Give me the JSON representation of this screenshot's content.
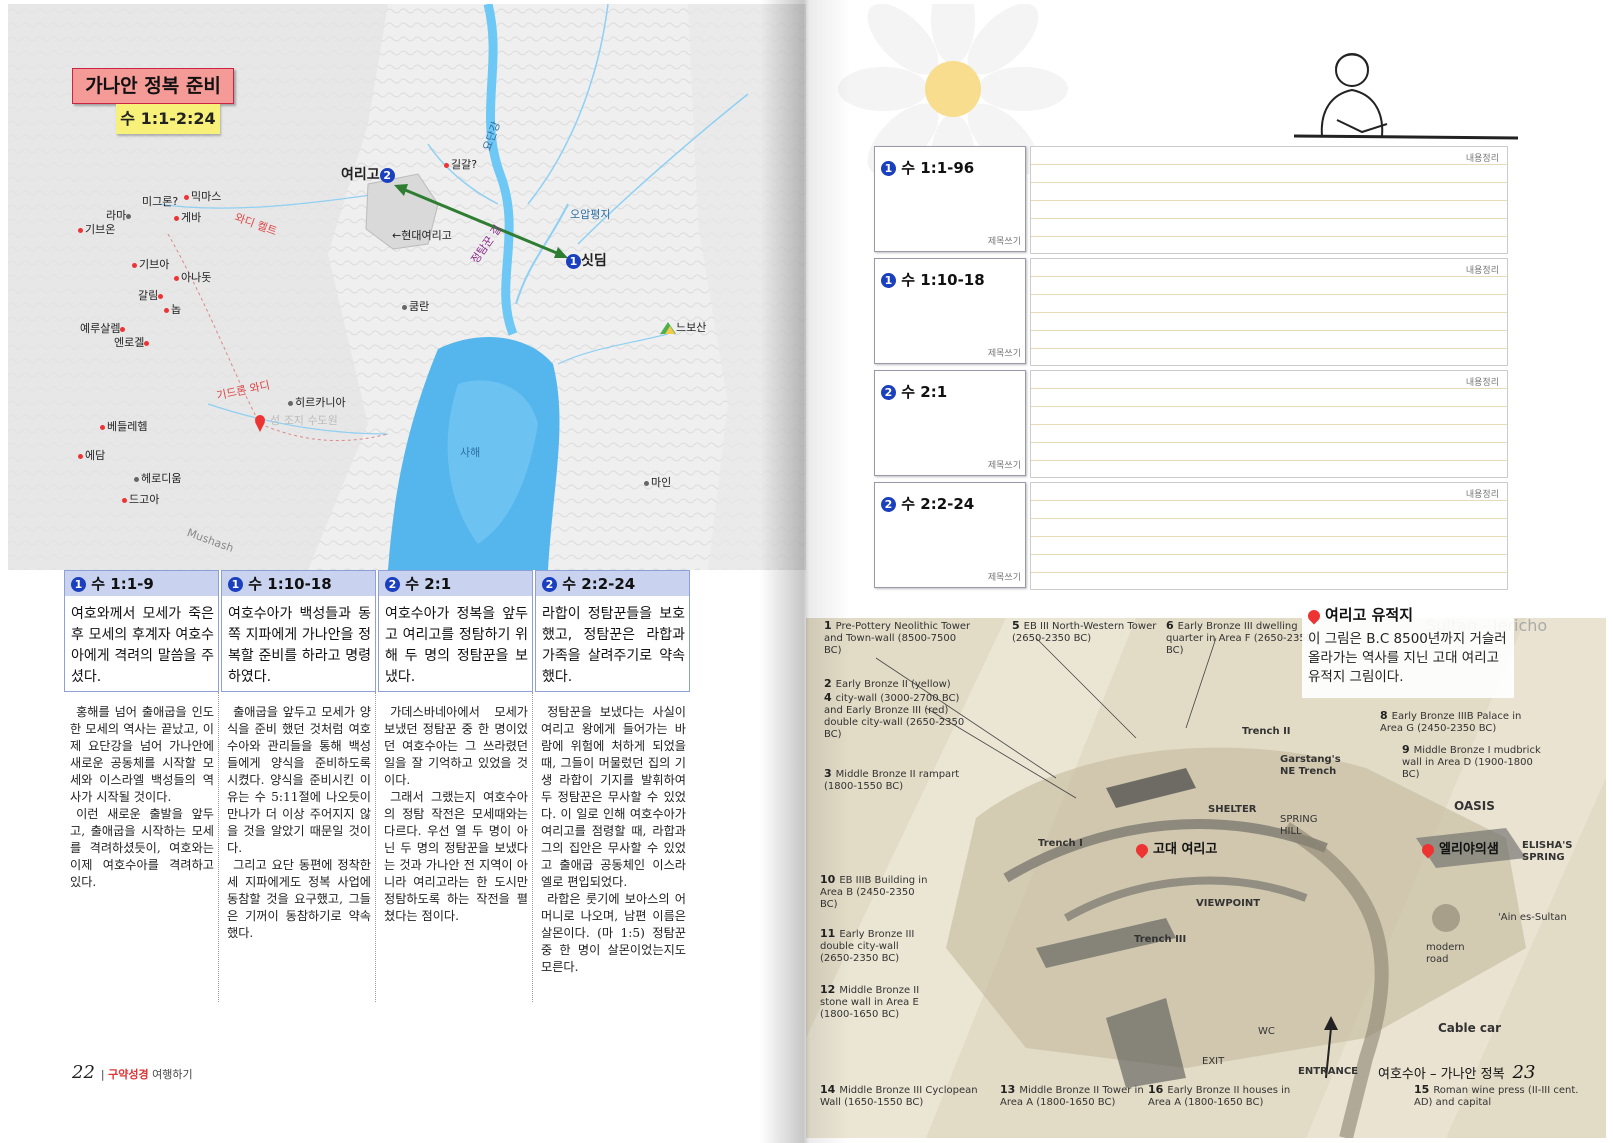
{
  "map": {
    "title": "가나안 정복 준비",
    "subtitle": "수 1:1-2:24",
    "places": {
      "jericho": "여리고",
      "gilgal": "길갈?",
      "migron": "미그론?",
      "michmash": "믹마스",
      "ramah": "라마",
      "geba": "게바",
      "gibeon": "기브온",
      "gibeah": "기브아",
      "anathoth": "아나돗",
      "gallim": "갈림",
      "nob": "놉",
      "jerusalem": "예루살렘",
      "emmaus": "엔로겔",
      "bethlehem": "베들레헴",
      "tekoa": "에담",
      "herodium": "헤로디움",
      "tekoa2": "드고아",
      "hyrcania": "히르카니아",
      "monastery": "성 조지 수도원",
      "kumran": "쿰란",
      "mainz": "마인",
      "shittim": "싯딤",
      "nebo": "느보산",
      "modern_jericho": "←현대여리고",
      "dead_sea": "사해",
      "jordan": "요단강",
      "wadi_kelt": "와디 켈트",
      "wadi_kidron": "기드론 와디",
      "spy_path": "정탐꾼 길",
      "wadi_nahal": "오압평지",
      "mushash": "Mushash"
    },
    "badge_jericho": "2",
    "badge_shittim": "1"
  },
  "columns": [
    {
      "badge": "1",
      "head": "수 1:1-9",
      "summary": "여호와께서 모세가 죽은 후 모세의 후계자 여호수아에게 격려의 말씀을 주셨다.",
      "body": [
        "홍해를 넘어 출애굽을 인도한 모세의 역사는 끝났고, 이제 요단강을 넘어 가나안에 새로운 공동체를 시작할 모세와 이스라엘 백성들의 역사가 시작될 것이다.",
        "이런 새로운 출발을 앞두고, 출애굽을 시작하는 모세를 격려하셨듯이, 여호와는 이제 여호수아를 격려하고 있다."
      ]
    },
    {
      "badge": "1",
      "head": "수 1:10-18",
      "summary": "여호수아가 백성들과 동쪽 지파에게 가나안을 정복할 준비를 하라고 명령하였다.",
      "body": [
        "출애굽을 앞두고 모세가 양식을 준비 했던 것처럼 여호수아와 관리들을 통해 백성들에게 양식을 준비하도록 시켰다. 양식을 준비시킨 이유는 수 5:11절에 나오듯이 만나가 더 이상 주어지지 않을 것을 알았기 때문일 것이다.",
        "그리고 요단 동편에 정착한 세 지파에게도 정복 사업에 동참할 것을 요구했고, 그들은 기꺼이 동참하기로 약속했다."
      ]
    },
    {
      "badge": "2",
      "head": "수 2:1",
      "summary": "여호수아가 정복을 앞두고 여리고를 정탐하기 위해 두 명의 정탐꾼을 보냈다.",
      "body": [
        "가데스바네아에서 모세가 보냈던 정탐꾼 중 한 명이었던 여호수아는 그 쓰라렸던 일을 잘 기억하고 있었을 것이다.",
        "그래서 그랬는지 여호수아의 정탐 작전은 모세때와는 다르다. 우선 열 두 명이 아닌 두 명의 정탐꾼을 보냈다는 것과 가나안 전 지역이 아니라 여리고라는 한 도시만 정탐하도록 하는 작전을 펼쳤다는 점이다."
      ]
    },
    {
      "badge": "2",
      "head": "수 2:2-24",
      "summary": "라합이 정탐꾼들을 보호했고, 정탐꾼은 라합과 가족을 살려주기로 약속했다.",
      "body": [
        "정탐꾼을 보냈다는 사실이 여리고 왕에게 들어가는 바람에 위험에 처하게 되었을 때, 그들이 머물렀던 집의 기생 라합이 기지를 발휘하여 두 정탐꾼은 무사할 수 있었다. 이 일로 인해 여호수아가 여리고를 점령할 때, 라합과 그의 집안은 무사할 수 있었고 출애굽 공동체인 이스라엘로 편입되었다.",
        "라합은 룻기에 보아스의 어머니로 나오며, 남편 이름은 살몬이다. (마 1:5) 정탐꾼 중 한 명이 살몬이었는지도 모른다."
      ]
    }
  ],
  "folio_left": {
    "page": "22",
    "book_a": "구약성경",
    "book_b": "여행하기"
  },
  "notes": [
    {
      "badge": "1",
      "label": "수 1:1-96",
      "hand_left": "제목쓰기",
      "hand_right": "내용정리"
    },
    {
      "badge": "1",
      "label": "수 1:10-18",
      "hand_left": "제목쓰기",
      "hand_right": "내용정리"
    },
    {
      "badge": "2",
      "label": "수 2:1",
      "hand_left": "제목쓰기",
      "hand_right": "내용정리"
    },
    {
      "badge": "2",
      "label": "수 2:2-24",
      "hand_left": "제목쓰기",
      "hand_right": "내용정리"
    }
  ],
  "sketch": {
    "callout_title": "여리고 유적지",
    "callout_body": "이 그림은 B.C 8500년까지 거슬러 올라가는 역사를 지닌 고대 여리고 유적지 그림이다.",
    "tag_ancient": "고대 여리고",
    "tag_elisha": "엘리야의샘",
    "legend": [
      {
        "n": "1",
        "t": "Pre-Pottery Neolithic Tower and Town-wall (8500-7500 BC)"
      },
      {
        "n": "5",
        "t": "EB III North-Western Tower (2650-2350 BC)"
      },
      {
        "n": "6",
        "t": "Early Bronze III dwelling quarter in Area F (2650-2350 BC)"
      },
      {
        "n": "2",
        "t": "Early Bronze II (yellow)"
      },
      {
        "n": "4",
        "t": "city-wall (3000-2700 BC) and Early Bronze III (red) double city-wall (2650-2350 BC)"
      },
      {
        "n": "3",
        "t": "Middle Bronze II rampart (1800-1550 BC)"
      },
      {
        "n": "8",
        "t": "Early Bronze IIIB Palace in Area G (2450-2350 BC)"
      },
      {
        "n": "9",
        "t": "Middle Bronze I mudbrick wall in Area D (1900-1800 BC)"
      },
      {
        "n": "10",
        "t": "EB IIIB Building in Area B (2450-2350 BC)"
      },
      {
        "n": "11",
        "t": "Early Bronze III double city-wall (2650-2350 BC)"
      },
      {
        "n": "12",
        "t": "Middle Bronze II stone wall in Area E (1800-1650 BC)"
      },
      {
        "n": "14",
        "t": "Middle Bronze III Cyclopean Wall (1650-1550 BC)"
      },
      {
        "n": "13",
        "t": "Middle Bronze II Tower in Area A (1800-1650 BC)"
      },
      {
        "n": "16",
        "t": "Early Bronze II houses in Area A (1800-1650 BC)"
      },
      {
        "n": "15",
        "t": "Roman wine press (II-III cent. AD) and capital"
      }
    ],
    "labels": {
      "trench1": "Trench I",
      "trench2": "Trench II",
      "trench3": "Trench III",
      "garstang": "Garstang's NE Trench",
      "shelter": "SHELTER",
      "spring_hill": "SPRING HILL",
      "viewpoint": "VIEWPOINT",
      "oasis": "OASIS",
      "elisha_spring": "ELISHA'S SPRING",
      "ain": "'Ain es-Sultan",
      "modern_road": "modern road",
      "cable_car": "Cable car",
      "entrance": "ENTRANCE",
      "exit": "EXIT",
      "wc": "WC",
      "top_title": "Sultan - Jericho"
    }
  },
  "folio_right": {
    "title": "여호수아 – 가나안 정복",
    "page": "23"
  }
}
